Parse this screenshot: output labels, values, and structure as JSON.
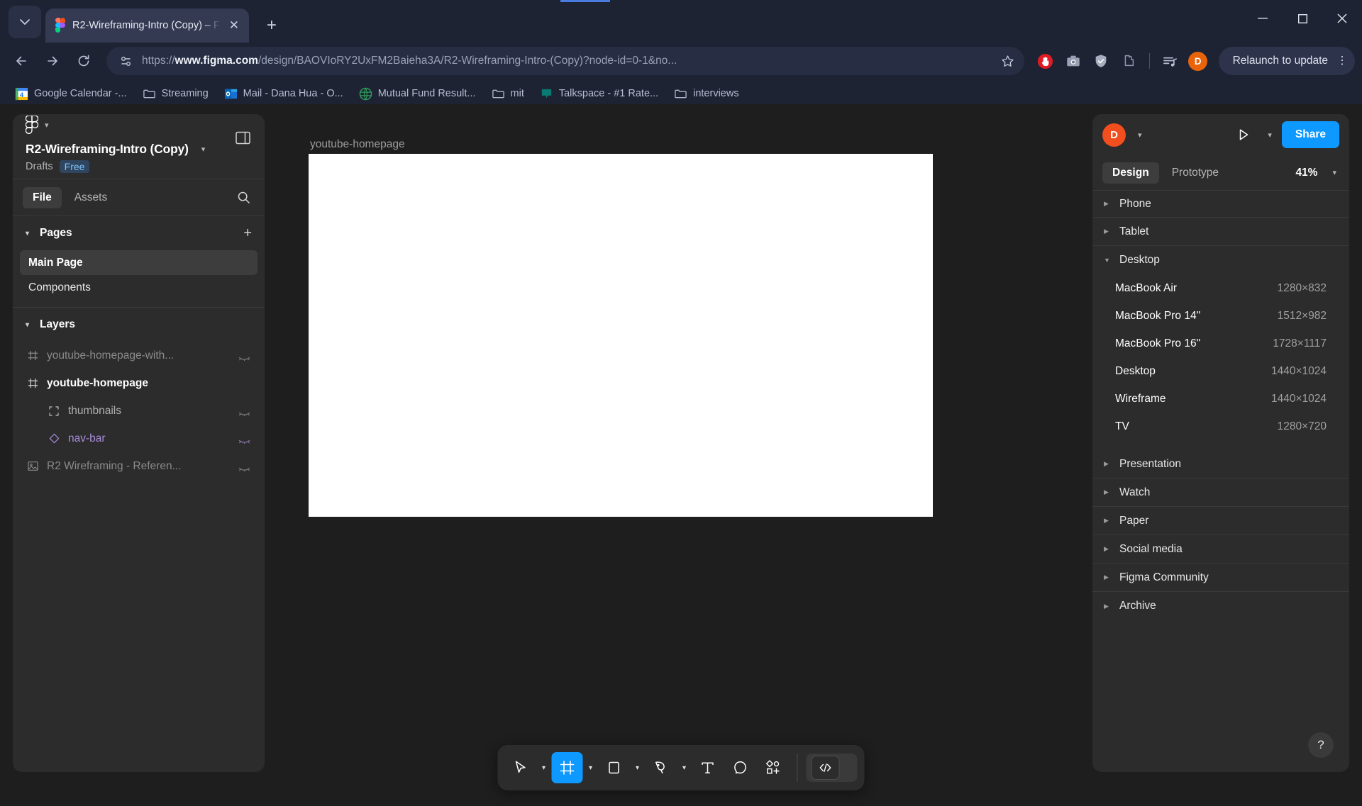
{
  "browser": {
    "tab": {
      "title": "R2-Wireframing-Intro (Copy) – F",
      "close_label": "✕"
    },
    "new_tab_label": "+",
    "window_controls": {
      "minimize": "—",
      "maximize": "❐",
      "close": "✕"
    },
    "url_prefix": "https://",
    "url_domain": "www.figma.com",
    "url_path": "/design/BAOVIoRY2UxFM2Baieha3A/R2-Wireframing-Intro-(Copy)?node-id=0-1&no...",
    "relaunch_label": "Relaunch to update",
    "profile_initial": "D",
    "bookmarks": [
      {
        "label": "Google Calendar -...",
        "icon": "calendar-icon"
      },
      {
        "label": "Streaming",
        "icon": "folder-icon"
      },
      {
        "label": "Mail - Dana Hua - O...",
        "icon": "outlook-icon"
      },
      {
        "label": "Mutual Fund Result...",
        "icon": "site-icon"
      },
      {
        "label": "mit",
        "icon": "folder-icon"
      },
      {
        "label": "Talkspace - #1 Rate...",
        "icon": "talkspace-icon"
      },
      {
        "label": "interviews",
        "icon": "folder-icon"
      }
    ]
  },
  "figma": {
    "left_panel": {
      "file_title": "R2-Wireframing-Intro (Copy)",
      "drafts_label": "Drafts",
      "plan_badge": "Free",
      "tabs": [
        {
          "label": "File",
          "active": true
        },
        {
          "label": "Assets",
          "active": false
        }
      ],
      "pages_section": {
        "label": "Pages",
        "add_label": "+"
      },
      "pages": [
        {
          "label": "Main Page",
          "active": true
        },
        {
          "label": "Components",
          "active": false
        }
      ],
      "layers_section": {
        "label": "Layers"
      },
      "layers": [
        {
          "name": "youtube-homepage-with...",
          "icon": "frame-icon",
          "dimmed": true,
          "indent": 0,
          "color": "#8a8a8a",
          "hidden": true
        },
        {
          "name": "youtube-homepage",
          "icon": "frame-icon",
          "dimmed": false,
          "indent": 0,
          "color": "#ffffff",
          "hidden": false
        },
        {
          "name": "thumbnails",
          "icon": "group-icon",
          "dimmed": true,
          "indent": 1,
          "color": "#b0b0b0",
          "hidden": true
        },
        {
          "name": "nav-bar",
          "icon": "component-icon",
          "dimmed": true,
          "indent": 1,
          "color": "#a78bd8",
          "hidden": true
        },
        {
          "name": "R2 Wireframing - Referen...",
          "icon": "image-icon",
          "dimmed": true,
          "indent": 0,
          "color": "#8a8a8a",
          "hidden": true
        }
      ]
    },
    "canvas": {
      "frame_label": "youtube-homepage"
    },
    "toolbar": [
      {
        "name": "move-tool",
        "icon": "cursor-icon",
        "active": false,
        "has_chevron": true
      },
      {
        "name": "frame-tool",
        "icon": "frame-icon",
        "active": true,
        "has_chevron": true
      },
      {
        "name": "shape-tool",
        "icon": "rectangle-icon",
        "active": false,
        "has_chevron": true
      },
      {
        "name": "pen-tool",
        "icon": "pen-icon",
        "active": false,
        "has_chevron": true
      },
      {
        "name": "text-tool",
        "icon": "text-icon",
        "active": false,
        "has_chevron": false
      },
      {
        "name": "comment-tool",
        "icon": "comment-icon",
        "active": false,
        "has_chevron": false
      },
      {
        "name": "actions-tool",
        "icon": "plugins-icon",
        "active": false,
        "has_chevron": false
      }
    ],
    "devmode_label": "</>",
    "right_panel": {
      "avatar_initial": "D",
      "share_label": "Share",
      "tabs": [
        {
          "label": "Design",
          "active": true
        },
        {
          "label": "Prototype",
          "active": false
        }
      ],
      "zoom": "41%",
      "categories_top": [
        {
          "label": "Phone",
          "expanded": false
        },
        {
          "label": "Tablet",
          "expanded": false
        }
      ],
      "desktop_section": {
        "label": "Desktop",
        "expanded": true
      },
      "devices": [
        {
          "name": "MacBook Air",
          "size": "1280×832"
        },
        {
          "name": "MacBook Pro 14\"",
          "size": "1512×982"
        },
        {
          "name": "MacBook Pro 16\"",
          "size": "1728×1117"
        },
        {
          "name": "Desktop",
          "size": "1440×1024"
        },
        {
          "name": "Wireframe",
          "size": "1440×1024"
        },
        {
          "name": "TV",
          "size": "1280×720"
        }
      ],
      "categories_bottom": [
        {
          "label": "Presentation",
          "expanded": false
        },
        {
          "label": "Watch",
          "expanded": false
        },
        {
          "label": "Paper",
          "expanded": false
        },
        {
          "label": "Social media",
          "expanded": false
        },
        {
          "label": "Figma Community",
          "expanded": false
        },
        {
          "label": "Archive",
          "expanded": false
        }
      ],
      "help_label": "?"
    }
  },
  "colors": {
    "figma_blue": "#0d99ff",
    "avatar_orange": "#f24e1e",
    "browser_bg": "#1e2333",
    "panel_bg": "#2c2c2c",
    "canvas_bg": "#1e1e1e"
  }
}
